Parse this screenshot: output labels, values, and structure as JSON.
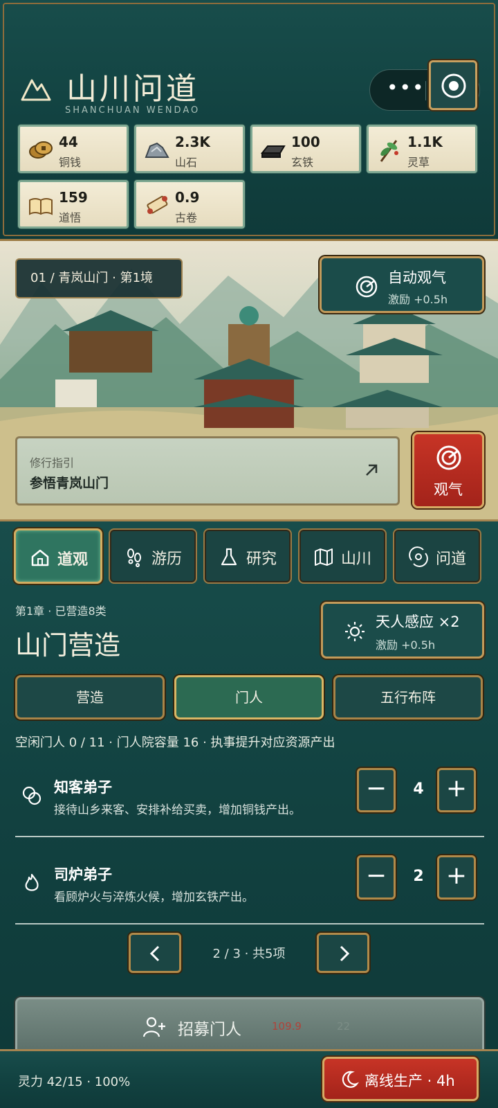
{
  "header": {
    "title": "山川问道",
    "subtitle": "SHANCHUAN WENDAO",
    "menu_icon": "more-dots-icon",
    "action_icon": "target-icon"
  },
  "resources": [
    {
      "value": "44",
      "label": "铜钱",
      "icon": "coins-icon"
    },
    {
      "value": "2.3K",
      "label": "山石",
      "icon": "stone-icon"
    },
    {
      "value": "100",
      "label": "玄铁",
      "icon": "iron-ingot-icon"
    },
    {
      "value": "1.1K",
      "label": "灵草",
      "icon": "herb-icon"
    },
    {
      "value": "159",
      "label": "道悟",
      "icon": "book-icon"
    },
    {
      "value": "0.9",
      "label": "古卷",
      "icon": "scroll-icon"
    }
  ],
  "scene": {
    "stage_label": "01 / 青岚山门 · 第1境",
    "auto_button": {
      "title": "自动观气",
      "sub": "激励 +0.5h"
    },
    "guide": {
      "title": "修行指引",
      "task": "参悟青岚山门"
    },
    "observe_label": "观气"
  },
  "tabs": [
    {
      "label": "道观",
      "icon": "home-icon",
      "active": true
    },
    {
      "label": "游历",
      "icon": "footprints-icon",
      "active": false
    },
    {
      "label": "研究",
      "icon": "flask-icon",
      "active": false
    },
    {
      "label": "山川",
      "icon": "map-icon",
      "active": false
    },
    {
      "label": "问道",
      "icon": "orbit-icon",
      "active": false
    }
  ],
  "section": {
    "chapter": "第1章 · 已营造8类",
    "title": "山门营造",
    "boost": {
      "title": "天人感应 ×2",
      "sub": "激励 +0.5h"
    }
  },
  "sub_tabs": [
    {
      "label": "营造",
      "active": false
    },
    {
      "label": "门人",
      "active": true
    },
    {
      "label": "五行布阵",
      "active": false
    }
  ],
  "info_line": "空闲门人 0 / 11 · 门人院容量 16 · 执事提升对应资源产出",
  "disciples": [
    {
      "name": "知客弟子",
      "desc": "接待山乡来客、安排补给买卖，增加铜钱产出。",
      "count": "4",
      "icon": "coins-outline-icon"
    },
    {
      "name": "司炉弟子",
      "desc": "看顾炉火与淬炼火候，增加玄铁产出。",
      "count": "2",
      "icon": "flame-icon"
    }
  ],
  "stepper": {
    "minus": "−",
    "plus": "+"
  },
  "pager": {
    "text": "2 / 3 · 共5项"
  },
  "recruit": {
    "label": "招募门人",
    "cost_coins": "109.9",
    "cost_herb": "22"
  },
  "footer": {
    "stat": "灵力 42/15 · 100%",
    "offline": "离线生产 · 4h"
  }
}
